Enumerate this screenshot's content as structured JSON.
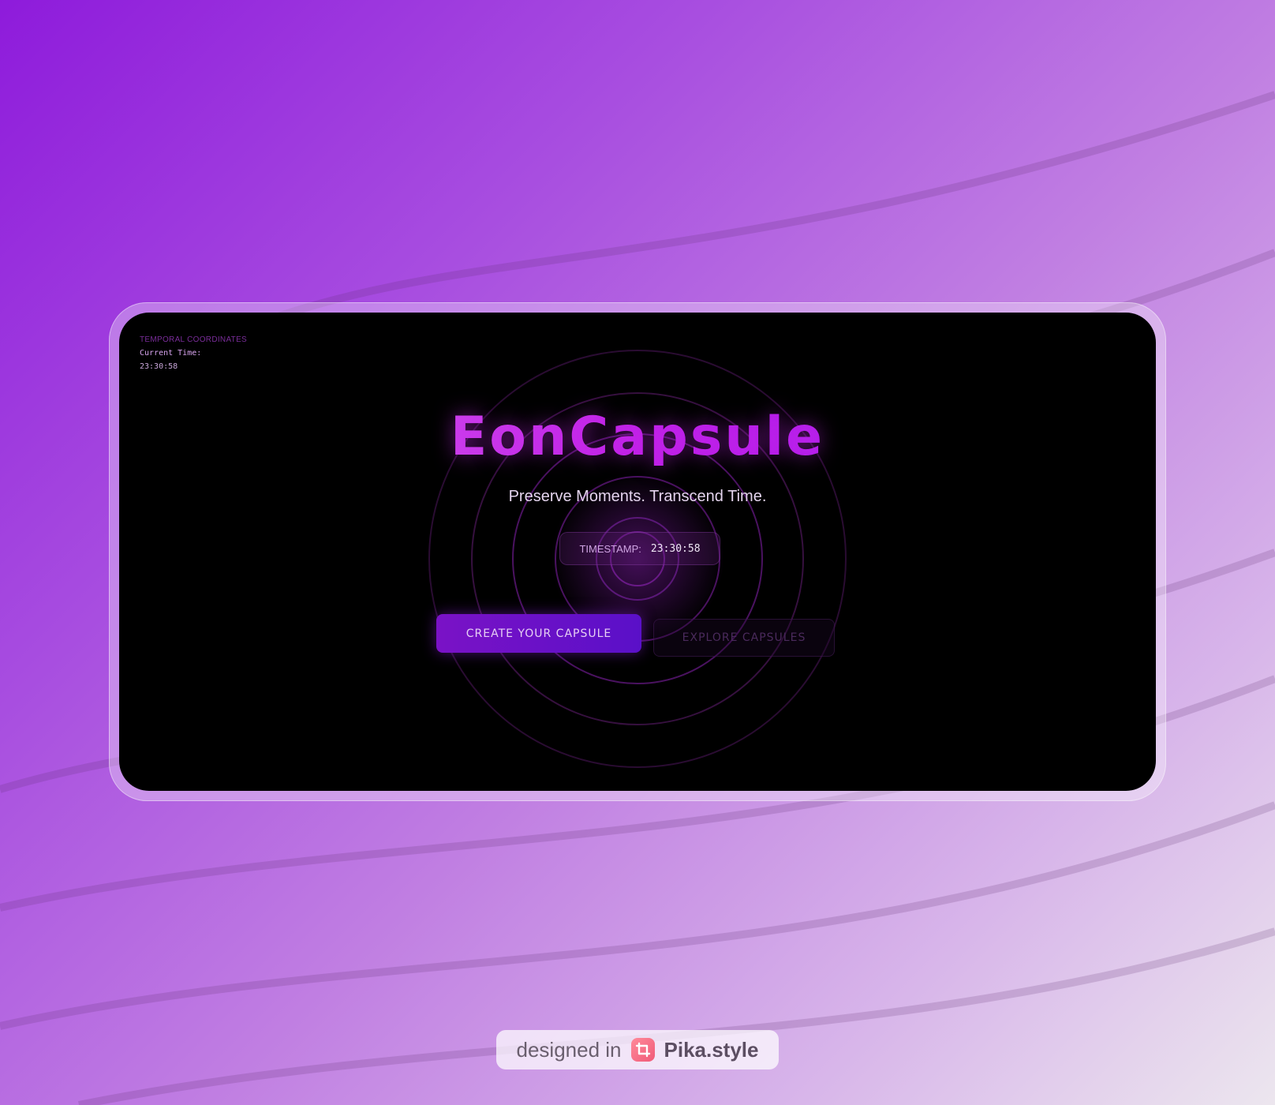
{
  "hero": {
    "coordinates_title": "TEMPORAL COORDINATES",
    "current_time_label": "Current Time:",
    "current_time_value": "23:30:58",
    "title": "EonCapsule",
    "subtitle": "Preserve Moments. Transcend Time.",
    "timestamp_label": "TIMESTAMP:",
    "timestamp_value": "23:30:58",
    "primary_button": "CREATE YOUR CAPSULE",
    "secondary_button": "EXPLORE CAPSULES"
  },
  "badge": {
    "prefix": "designed in",
    "brand": "Pika.style",
    "icon": "crop-icon"
  },
  "colors": {
    "accent": "#c020e6",
    "button": "#6a12c8",
    "background": "#000000"
  }
}
